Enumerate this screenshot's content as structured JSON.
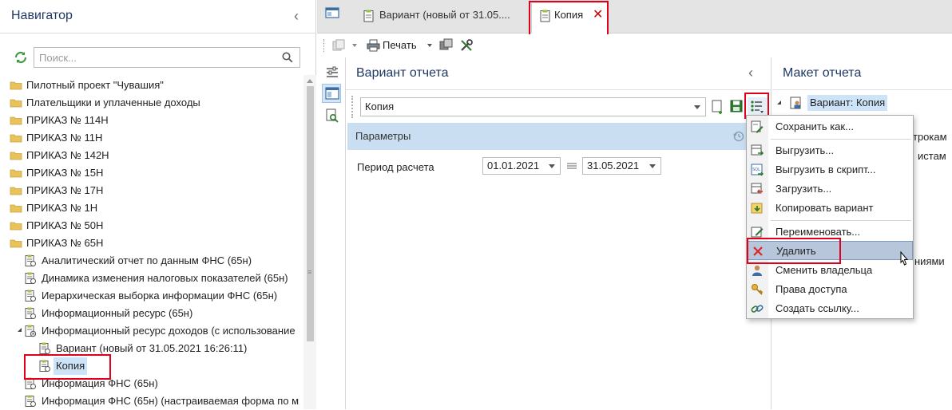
{
  "navigator": {
    "title": "Навигатор",
    "search_placeholder": "Поиск...",
    "folders": [
      "Пилотный проект \"Чувашия\"",
      "Плательщики и уплаченные доходы",
      "ПРИКАЗ № 114Н",
      "ПРИКАЗ № 11Н",
      "ПРИКАЗ № 142Н",
      "ПРИКАЗ № 15Н",
      "ПРИКАЗ № 17Н",
      "ПРИКАЗ № 1Н",
      "ПРИКАЗ № 50Н",
      "ПРИКАЗ № 65Н"
    ],
    "reports": [
      "Аналитический отчет по данным ФНС (65н)",
      "Динамика изменения налоговых показателей (65н)",
      "Иерархическая выборка информации ФНС (65н)",
      "Информационный ресурс (65н)",
      "Информационный ресурс доходов (с использование"
    ],
    "variants": [
      "Вариант (новый от 31.05.2021 16:26:11)",
      "Копия"
    ],
    "reports_after": [
      "Информация ФНС (65н)",
      "Информация ФНС (65н) (настраиваемая форма по м"
    ]
  },
  "tabs": {
    "variant": "Вариант (новый от 31.05....",
    "copy": "Копия",
    "close_glyph": "✕"
  },
  "toolbar": {
    "print_label": "Печать"
  },
  "variant_panel": {
    "title": "Вариант отчета",
    "selected_variant": "Копия",
    "params_label": "Параметры",
    "period_label": "Период расчета",
    "date_from": "01.01.2021",
    "date_to": "31.05.2021"
  },
  "layout_panel": {
    "title": "Макет отчета",
    "node_label": "Вариант: Копия",
    "fragments": [
      "трокам",
      "истам",
      "ниями"
    ]
  },
  "context_menu": {
    "items": [
      {
        "label": "Сохранить как...",
        "icon": "save-as-icon"
      },
      {
        "label": "Выгрузить...",
        "icon": "export-icon"
      },
      {
        "label": "Выгрузить в скрипт...",
        "icon": "sql-script-icon"
      },
      {
        "label": "Загрузить...",
        "icon": "import-icon"
      },
      {
        "label": "Копировать вариант",
        "icon": "copy-variant-icon"
      },
      {
        "label": "Переименовать...",
        "icon": "rename-icon"
      },
      {
        "label": "Удалить",
        "icon": "delete-icon"
      },
      {
        "label": "Сменить владельца",
        "icon": "change-owner-icon"
      },
      {
        "label": "Права доступа",
        "icon": "access-rights-icon"
      },
      {
        "label": "Создать ссылку...",
        "icon": "link-icon"
      }
    ],
    "hovered_item": "Удалить"
  },
  "colors": {
    "accent_title": "#1f3864",
    "selection": "#cde3f7",
    "params_bar": "#c9dff1",
    "menu_hover": "#b7c6db",
    "highlight_red": "#e0001b",
    "folder": "#e8c25a"
  }
}
